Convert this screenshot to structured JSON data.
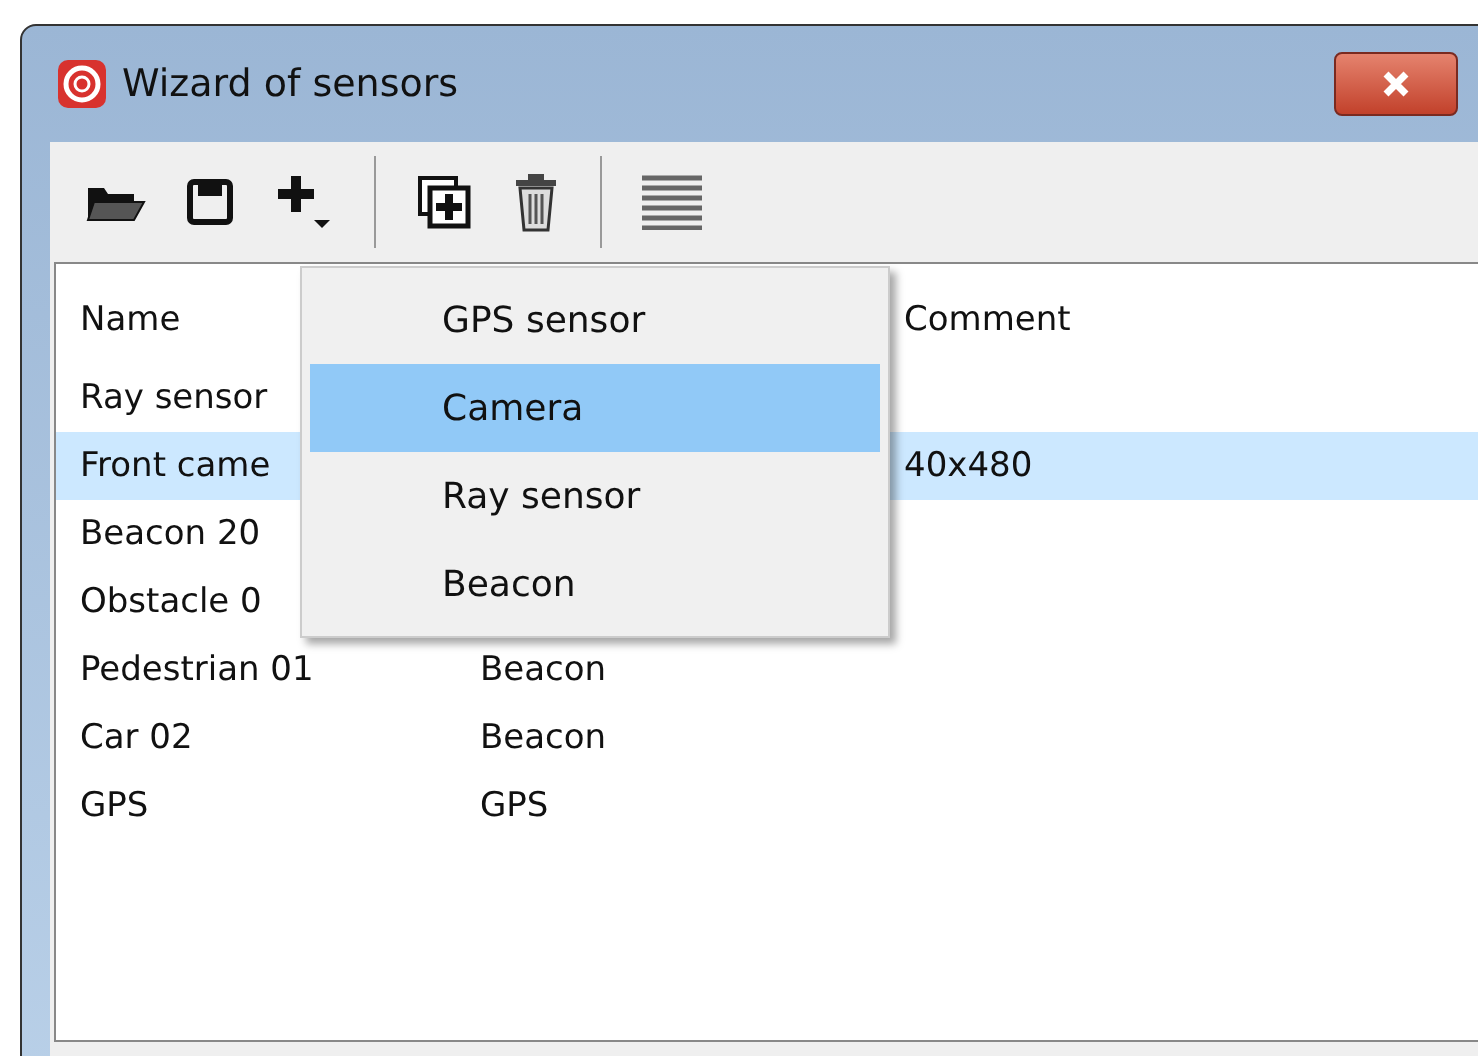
{
  "window": {
    "title": "Wizard of sensors"
  },
  "table": {
    "columns": [
      "Name",
      "Comment"
    ],
    "rows": [
      {
        "name": "Ray sensor",
        "type": "",
        "comment": "",
        "selected": false
      },
      {
        "name": "Front came",
        "type": "",
        "comment": "40x480",
        "selected": true
      },
      {
        "name": "Beacon 20",
        "type": "",
        "comment": "",
        "selected": false
      },
      {
        "name": "Obstacle 0",
        "type": "",
        "comment": "",
        "selected": false
      },
      {
        "name": "Pedestrian 01",
        "type": "Beacon",
        "comment": "",
        "selected": false
      },
      {
        "name": "Car 02",
        "type": "Beacon",
        "comment": "",
        "selected": false
      },
      {
        "name": "GPS",
        "type": "GPS",
        "comment": "",
        "selected": false
      }
    ]
  },
  "add_menu": {
    "items": [
      {
        "label": "GPS sensor",
        "selected": false
      },
      {
        "label": "Camera",
        "selected": true
      },
      {
        "label": "Ray sensor",
        "selected": false
      },
      {
        "label": "Beacon",
        "selected": false
      }
    ]
  }
}
